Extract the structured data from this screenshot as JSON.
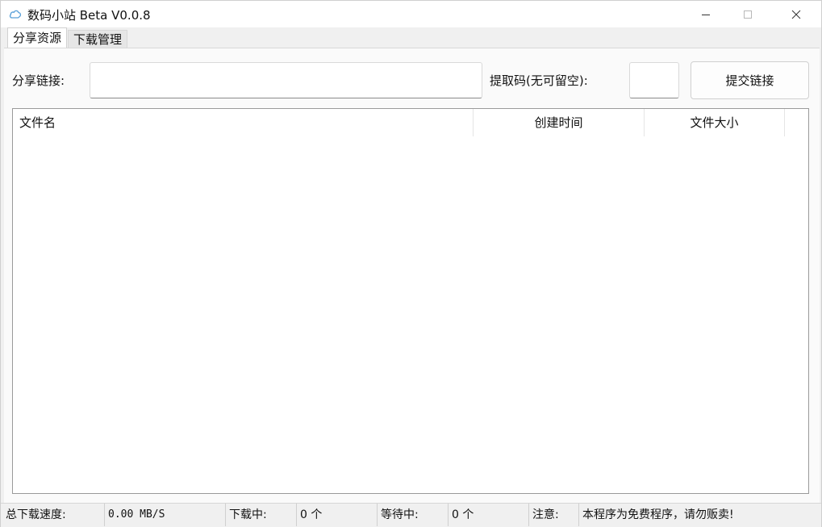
{
  "window": {
    "title": "数码小站 Beta V0.0.8",
    "icon": "cloud-icon",
    "controls": [
      "minimize-icon",
      "maximize-icon",
      "close-icon"
    ]
  },
  "tabs": [
    {
      "label": "分享资源",
      "active": true
    },
    {
      "label": "下载管理",
      "active": false
    }
  ],
  "form": {
    "share_link_label": "分享链接:",
    "share_link_value": "",
    "code_label": "提取码(无可留空):",
    "code_value": "",
    "submit_label": "提交链接"
  },
  "file_table": {
    "columns": [
      "文件名",
      "创建时间",
      "文件大小"
    ],
    "rows": []
  },
  "status_bar": {
    "speed_label": "总下载速度:",
    "speed_value": "0.00 MB/S",
    "downloading_label": "下载中:",
    "downloading_value": "0 个",
    "waiting_label": "等待中:",
    "waiting_value": "0 个",
    "notice_label": "注意:",
    "notice_value": "本程序为免费程序，请勿贩卖!"
  },
  "colors": {
    "window_bg": "#f0f0f0",
    "titlebar_bg": "#ffffff",
    "icon_accent": "#5aa0d8"
  }
}
